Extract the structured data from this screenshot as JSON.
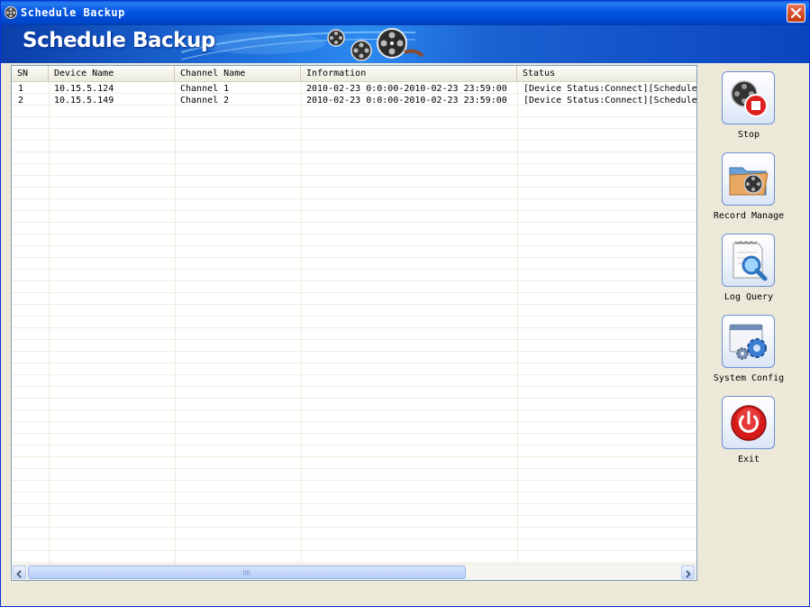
{
  "window": {
    "title": "Schedule Backup",
    "banner_title": "Schedule Backup"
  },
  "table": {
    "columns": [
      "SN",
      "Device Name",
      "Channel Name",
      "Information",
      "Status"
    ],
    "rows": [
      {
        "sn": "1",
        "device": "10.15.5.124",
        "channel": "Channel 1",
        "info": "2010-02-23 0:0:00-2010-02-23 23:59:00",
        "status": "[Device Status:Connect][Schedule"
      },
      {
        "sn": "2",
        "device": "10.15.5.149",
        "channel": "Channel 2",
        "info": "2010-02-23 0:0:00-2010-02-23 23:59:00",
        "status": "[Device Status:Connect][Schedule"
      }
    ]
  },
  "actions": {
    "stop": "Stop",
    "record_manage": "Record Manage",
    "log_query": "Log Query",
    "system_config": "System Config",
    "exit": "Exit"
  },
  "colors": {
    "titlebar": "#0054e3",
    "banner": "#1e6fdc",
    "window_bg": "#ece9d8",
    "close": "#d34a22"
  }
}
